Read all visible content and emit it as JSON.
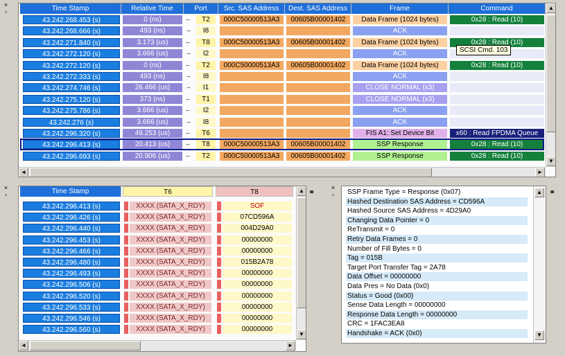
{
  "top_table": {
    "headers": [
      "Time Stamp",
      "Relative Time",
      "Port",
      "Src. SAS Address",
      "Dest. SAS Address",
      "Frame",
      "Command"
    ],
    "rows": [
      {
        "ts": "43.242.268.453 (s)",
        "rel": "0 (ns)",
        "dir": "left",
        "port": "T2",
        "src": "000C50000513A3",
        "dst": "00605B00001402",
        "frame": "Data Frame (1024 bytes)",
        "ftype": "data",
        "cmd": "0x28 : Read (10)",
        "ctype": "g"
      },
      {
        "ts": "43.242.268.666 (s)",
        "rel": "493 (ns)",
        "dir": "right",
        "port": "I8",
        "src": "",
        "dst": "",
        "frame": "ACK",
        "ftype": "ack",
        "cmd": "",
        "ctype": "e"
      },
      {
        "ts": "43.242.271.840 (s)",
        "rel": "3.173 (us)",
        "dir": "left",
        "port": "T8",
        "src": "000C50000513A3",
        "dst": "00605B00001402",
        "frame": "Data Frame (1024 bytes)",
        "ftype": "data",
        "cmd": "0x28 : Read (10)",
        "ctype": "g"
      },
      {
        "ts": "43.242.272.120 (s)",
        "rel": "3.666 (us)",
        "dir": "right",
        "port": "I2",
        "src": "",
        "dst": "",
        "frame": "ACK",
        "ftype": "ack",
        "cmd": "",
        "ctype": "e"
      },
      {
        "ts": "43.242.272.120 (s)",
        "rel": "0 (ns)",
        "dir": "left",
        "port": "T2",
        "src": "000C50000513A3",
        "dst": "00605B00001402",
        "frame": "Data Frame (1024 bytes)",
        "ftype": "data",
        "cmd": "0x28 : Read (10)",
        "ctype": "g"
      },
      {
        "ts": "43.242.272.333 (s)",
        "rel": "493 (ns)",
        "dir": "right",
        "port": "I8",
        "src": "",
        "dst": "",
        "frame": "ACK",
        "ftype": "ack",
        "cmd": "",
        "ctype": "e"
      },
      {
        "ts": "43.242.274.746 (s)",
        "rel": "26.466 (us)",
        "dir": "right",
        "port": "I1",
        "src": "",
        "dst": "",
        "frame": "CLOSE NORMAL (x3)",
        "ftype": "close",
        "cmd": "",
        "ctype": "e"
      },
      {
        "ts": "43.242.275.120 (s)",
        "rel": "373 (ns)",
        "dir": "left",
        "port": "T1",
        "src": "",
        "dst": "",
        "frame": "CLOSE NORMAL (x3)",
        "ftype": "close",
        "cmd": "",
        "ctype": "e"
      },
      {
        "ts": "43.242.275.786 (s)",
        "rel": "3.666 (us)",
        "dir": "left",
        "port": "I2",
        "src": "",
        "dst": "",
        "frame": "ACK",
        "ftype": "ack",
        "cmd": "",
        "ctype": "e"
      },
      {
        "ts": "43.242.276 (s)",
        "rel": "3.666 (us)",
        "dir": "right",
        "port": "I8",
        "src": "",
        "dst": "",
        "frame": "ACK",
        "ftype": "ack",
        "cmd": "",
        "ctype": "e"
      },
      {
        "ts": "43.242.296.320 (s)",
        "rel": "49.253 (us)",
        "dir": "left",
        "port": "T6",
        "src": "",
        "dst": "",
        "frame": "FIS A1: Set Device Bit",
        "ftype": "fis",
        "cmd": "x60 : Read FPDMA Queue",
        "ctype": "n"
      },
      {
        "ts": "43.242.296.413 (s)",
        "rel": "20.413 (us)",
        "dir": "left",
        "port": "T8",
        "src": "000C50000513A3",
        "dst": "00605B00001402",
        "frame": "SSP Response",
        "ftype": "ssp",
        "cmd": "0x28 : Read (10)",
        "ctype": "g"
      },
      {
        "ts": "43.242.296.693 (s)",
        "rel": "20.906 (us)",
        "dir": "left",
        "port": "T2",
        "src": "000C50000513A3",
        "dst": "00605B00001402",
        "frame": "SSP Response",
        "ftype": "ssp",
        "cmd": "0x28 : Read (10)",
        "ctype": "g"
      }
    ],
    "tooltip": "SCSI Cmd. 103"
  },
  "bottom_left": {
    "headers": [
      "Time Stamp",
      "T6",
      "T8"
    ],
    "rows": [
      {
        "ts": "43.242.296.413 (s)",
        "t6": "XXXX (SATA_X_RDY)",
        "t8": "SOF"
      },
      {
        "ts": "43.242.296.426 (s)",
        "t6": "XXXX (SATA_X_RDY)",
        "t8": "07CD596A"
      },
      {
        "ts": "43.242.296.440 (s)",
        "t6": "XXXX (SATA_X_RDY)",
        "t8": "004D29A0"
      },
      {
        "ts": "43.242.296.453 (s)",
        "t6": "XXXX (SATA_X_RDY)",
        "t8": "00000000"
      },
      {
        "ts": "43.242.296.466 (s)",
        "t6": "XXXX (SATA_X_RDY)",
        "t8": "00000000"
      },
      {
        "ts": "43.242.296.480 (s)",
        "t6": "XXXX (SATA_X_RDY)",
        "t8": "015B2A78"
      },
      {
        "ts": "43.242.296.493 (s)",
        "t6": "XXXX (SATA_X_RDY)",
        "t8": "00000000"
      },
      {
        "ts": "43.242.296.506 (s)",
        "t6": "XXXX (SATA_X_RDY)",
        "t8": "00000000"
      },
      {
        "ts": "43.242.296.520 (s)",
        "t6": "XXXX (SATA_X_RDY)",
        "t8": "00000000"
      },
      {
        "ts": "43.242.296.533 (s)",
        "t6": "XXXX (SATA_X_RDY)",
        "t8": "00000000"
      },
      {
        "ts": "43.242.296.546 (s)",
        "t6": "XXXX (SATA_X_RDY)",
        "t8": "00000000"
      },
      {
        "ts": "43.242.296.560 (s)",
        "t6": "XXXX (SATA_X_RDY)",
        "t8": "00000000"
      }
    ]
  },
  "details": {
    "lines": [
      "SSP Frame Type = Response (0x07)",
      "Hashed Destination SAS Address = CD596A",
      "Hashed Source SAS Address = 4D29A0",
      "Changing Data Pointer = 0",
      "ReTransmit = 0",
      "Retry Data Frames = 0",
      "Number of Fill Bytes = 0",
      "Tag = 015B",
      "Target Port Transfer Tag = 2A78",
      "Data Offset = 00000000",
      "Data Pres = No Data (0x0)",
      "Status = Good (0x00)",
      "Sense Data Length = 00000000",
      "Response Data Length = 00000000",
      "CRC = 1FAC3EA8",
      "Handshake = ACK (0x0)"
    ]
  },
  "icons": {
    "close": "×",
    "minimize": "▫",
    "pin": "⚭",
    "up": "▲",
    "down": "▼",
    "left": "◄",
    "right": "►"
  }
}
